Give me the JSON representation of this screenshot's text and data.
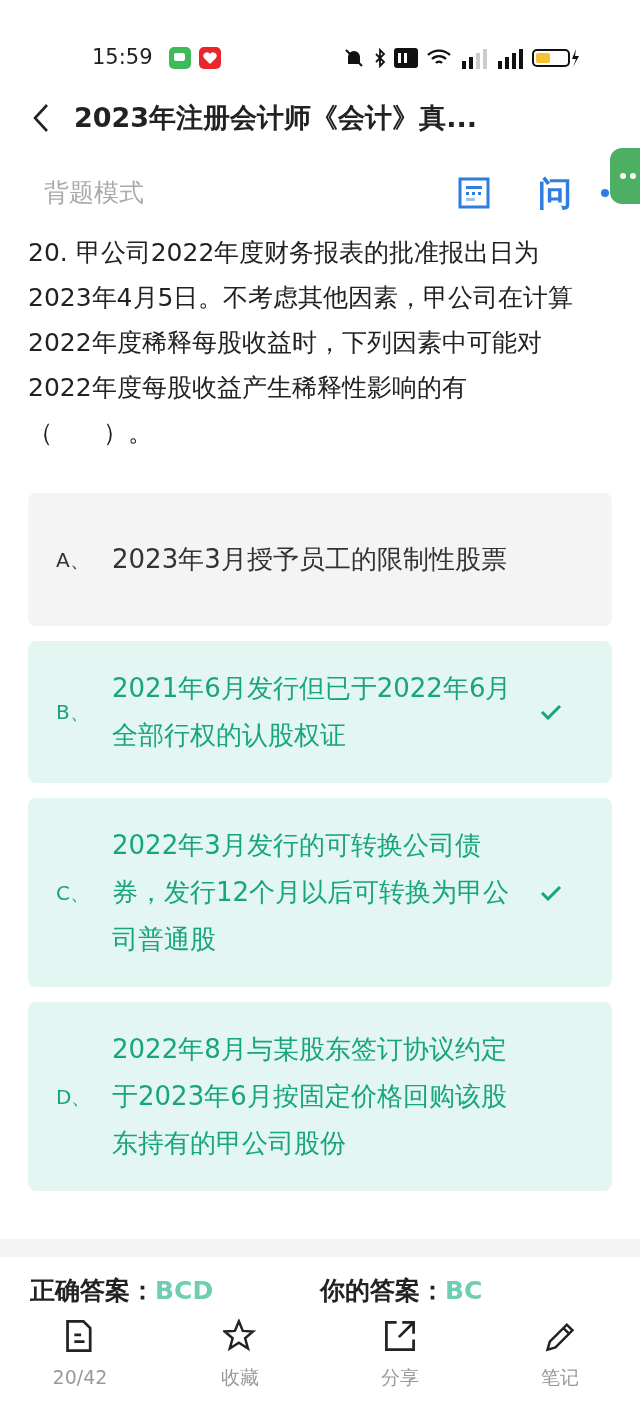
{
  "status_bar": {
    "time": "15:59"
  },
  "header": {
    "title": "2023年注册会计师《会计》真..."
  },
  "mode": {
    "label": "背题模式",
    "icon_text": "问"
  },
  "question": {
    "text": "20. 甲公司2022年度财务报表的批准报出日为2023年4月5日。不考虑其他因素，甲公司在计算2022年度稀释每股收益时，下列因素中可能对2022年度每股收益产生稀释性影响的有（　　）。"
  },
  "options": [
    {
      "letter": "A、",
      "text": "2023年3月授予员工的限制性股票",
      "correct": false,
      "selected": false
    },
    {
      "letter": "B、",
      "text": "2021年6月发行但已于2022年6月全部行权的认股权证",
      "correct": true,
      "selected": true
    },
    {
      "letter": "C、",
      "text": "2022年3月发行的可转换公司债券，发行12个月以后可转换为甲公司普通股",
      "correct": true,
      "selected": true
    },
    {
      "letter": "D、",
      "text": "2022年8月与某股东签订协议约定于2023年6月按固定价格回购该股东持有的甲公司股份",
      "correct": true,
      "selected": false
    }
  ],
  "answers": [
    {
      "label": "正确答案：",
      "value": "BCD"
    },
    {
      "label": "你的答案：",
      "value": "BC"
    }
  ],
  "bottom_nav": [
    {
      "kind": "sheet",
      "label": "20/42"
    },
    {
      "kind": "star",
      "label": "收藏"
    },
    {
      "kind": "share",
      "label": "分享"
    },
    {
      "kind": "pencil",
      "label": "笔记"
    }
  ]
}
